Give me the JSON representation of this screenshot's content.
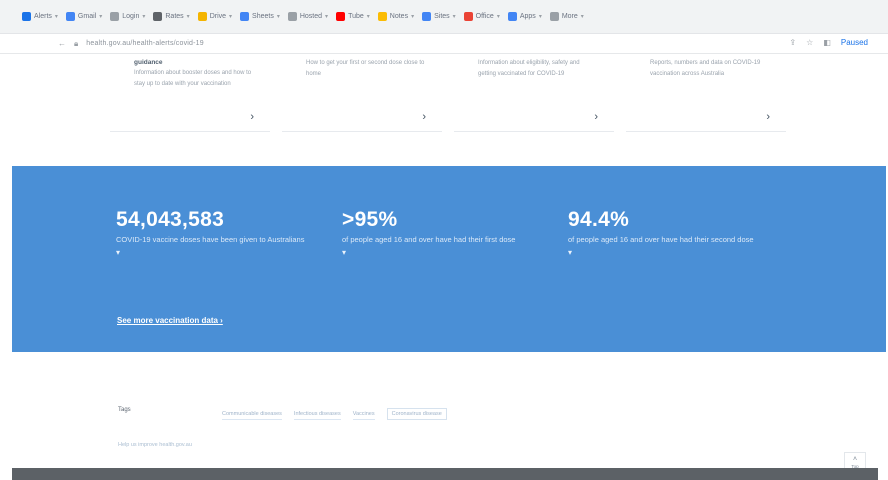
{
  "bookmarks": [
    {
      "label": "Alerts",
      "icon": "bookmark-folder-icon",
      "color": "#1a73e8"
    },
    {
      "label": "Gmail",
      "icon": "grid-icon",
      "color": "#4285f4"
    },
    {
      "label": "Login",
      "icon": "page-icon",
      "color": "#9aa0a6"
    },
    {
      "label": "Rates",
      "icon": "link-icon",
      "color": "#5f6368"
    },
    {
      "label": "Drive",
      "icon": "pen-icon",
      "color": "#f4b400"
    },
    {
      "label": "Sheets",
      "icon": "grid-icon",
      "color": "#4285f4"
    },
    {
      "label": "Hosted",
      "icon": "page-icon",
      "color": "#9aa0a6"
    },
    {
      "label": "Tube",
      "icon": "video-icon",
      "color": "#ff0000"
    },
    {
      "label": "Notes",
      "icon": "doc-icon",
      "color": "#fbbc04"
    },
    {
      "label": "Sites",
      "icon": "grid-icon",
      "color": "#4285f4"
    },
    {
      "label": "Office",
      "icon": "office-icon",
      "color": "#ea4335"
    },
    {
      "label": "Apps",
      "icon": "grid-icon",
      "color": "#4285f4"
    },
    {
      "label": "More",
      "icon": "folder-icon",
      "color": "#9aa0a6"
    }
  ],
  "address": {
    "url": "health.gov.au/health-alerts/covid-19",
    "account": "Paused"
  },
  "cards": [
    {
      "heading": "guidance",
      "text": "Information about booster doses and how to stay up to date with your vaccination",
      "arrow": "›"
    },
    {
      "heading": "",
      "text": "How to get your first or second dose close to home",
      "arrow": "›"
    },
    {
      "heading": "",
      "text": "Information about eligibility, safety and getting vaccinated for COVID-19",
      "arrow": "›"
    },
    {
      "heading": "",
      "text": "Reports, numbers and data on COVID-19 vaccination across Australia",
      "arrow": "›"
    }
  ],
  "banner": {
    "color": "#4a8fd6",
    "stats": [
      {
        "value": "54,043,583",
        "description": "COVID-19 vaccine doses have been given to Australians",
        "chevron": "▾"
      },
      {
        "value": ">95%",
        "description": "of people aged 16 and over have had their first dose",
        "chevron": "▾"
      },
      {
        "value": "94.4%",
        "description": "of people aged 16 and over have had their second dose",
        "chevron": "▾"
      }
    ],
    "more_link": "See more vaccination data ›"
  },
  "tags": {
    "label": "Tags",
    "items": [
      "Communicable diseases",
      "Infectious diseases",
      "Vaccines",
      "Coronavirus disease"
    ],
    "more": "Help us improve health.gov.au"
  },
  "scroll_top": {
    "label": "Top",
    "arrow": "˄"
  }
}
